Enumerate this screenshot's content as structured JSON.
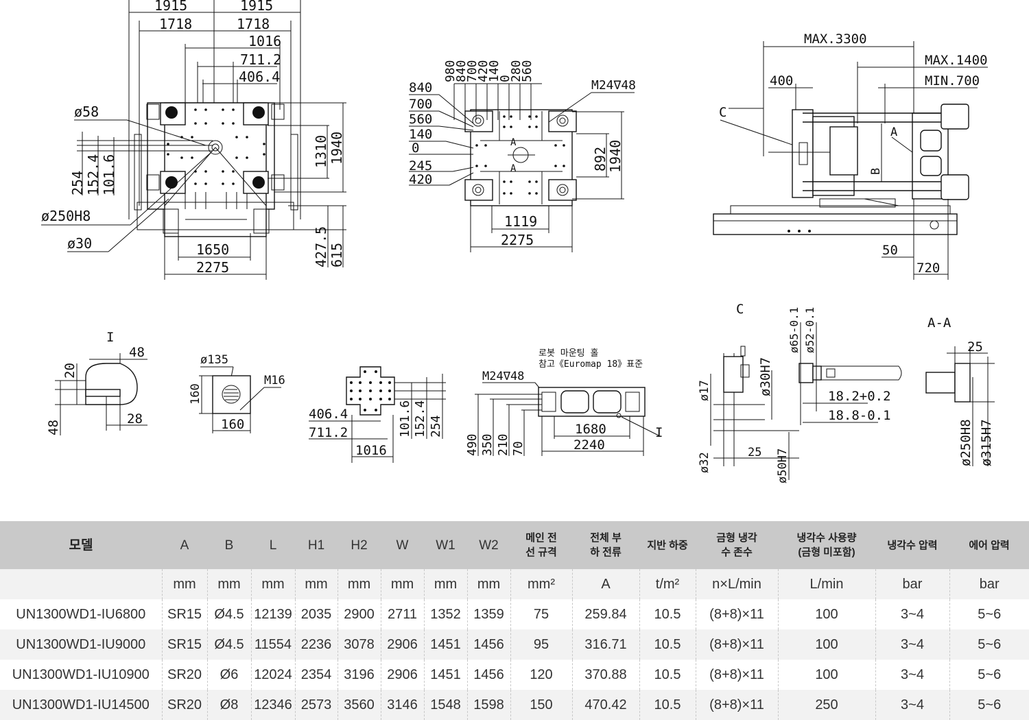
{
  "drawing_labels": {
    "top_1915_left": "1915",
    "top_1915_right": "1915",
    "top_1718_left": "1718",
    "top_1718_right": "1718",
    "top_1016": "1016",
    "top_711": "711.2",
    "top_406": "406.4",
    "phi58": "ø58",
    "d254": "254",
    "d152": "152.4",
    "d101": "101.6",
    "phi250": "ø250H8",
    "phi30": "ø30",
    "d1310": "1310",
    "d1940a": "1940",
    "d1650": "1650",
    "d2275a": "2275",
    "d427": "427.5",
    "d615": "615",
    "mid_980": "980",
    "mid_840v": "840",
    "mid_700v": "700",
    "mid_420v": "420",
    "mid_140v": "140",
    "mid_0v": "0",
    "mid_280v": "280",
    "mid_560v": "560",
    "mid_840": "840",
    "mid_700": "700",
    "mid_560": "560",
    "mid_140": "140",
    "mid_0": "0",
    "mid_245": "245",
    "mid_420": "420",
    "m24_top": "M24∇48",
    "d892": "892",
    "d1940b": "1940",
    "d1119": "1119",
    "d2275b": "2275",
    "sec_a": "A",
    "max3300": "MAX.3300",
    "max1400": "MAX.1400",
    "min700": "MIN.700",
    "d400": "400",
    "label_c": "C",
    "label_a": "A",
    "label_b": "B",
    "d50": "50",
    "d720": "720",
    "det_i": "I",
    "det_i_48a": "48",
    "det_i_20": "20",
    "det_i_48b": "48",
    "det_i_28": "28",
    "phi135": "ø135",
    "m16": "M16",
    "d160v": "160",
    "d160h": "160",
    "det2_406": "406.4",
    "det2_711": "711.2",
    "det2_1016": "1016",
    "det2_101": "101.6",
    "det2_152": "152.4",
    "det2_254": "254",
    "robot_note_1": "로봇 마운팅 홀",
    "robot_note_2": "참고《Euromap 18》표준",
    "m24_bottom": "M24∇48",
    "d490": "490",
    "d350": "350",
    "d210": "210",
    "d70": "70",
    "d1680": "1680",
    "d2240": "2240",
    "det_i_ref": "I",
    "sec_c": "C",
    "phi17": "ø17",
    "phi30h7": "ø30H7",
    "phi65": "ø65-0.1",
    "phi52": "ø52-0.1",
    "d18_2": "18.2+0.2",
    "d18_8": "18.8-0.1",
    "phi32": "ø32",
    "d25c": "25",
    "phi50h7": "ø50H7",
    "sec_aa": "A-A",
    "d25aa": "25",
    "phi250h8": "ø250H8",
    "phi315h7": "ø315H7"
  },
  "table": {
    "headers": [
      "모델",
      "A",
      "B",
      "L",
      "H1",
      "H2",
      "W",
      "W1",
      "W2",
      "메인 전\n선 규격",
      "전체 부\n하 전류",
      "지반 하중",
      "금형 냉각\n수 존수",
      "냉각수 사용량\n(금형 미포함)",
      "냉각수 압력",
      "에어 압력"
    ],
    "units": [
      "",
      "mm",
      "mm",
      "mm",
      "mm",
      "mm",
      "mm",
      "mm",
      "mm",
      "mm²",
      "A",
      "t/m²",
      "n×L/min",
      "L/min",
      "bar",
      "bar"
    ],
    "rows": [
      [
        "UN1300WD1-IU6800",
        "SR15",
        "Ø4.5",
        "12139",
        "2035",
        "2900",
        "2711",
        "1352",
        "1359",
        "75",
        "259.84",
        "10.5",
        "(8+8)×11",
        "100",
        "3~4",
        "5~6"
      ],
      [
        "UN1300WD1-IU9000",
        "SR15",
        "Ø4.5",
        "11554",
        "2236",
        "3078",
        "2906",
        "1451",
        "1456",
        "95",
        "316.71",
        "10.5",
        "(8+8)×11",
        "100",
        "3~4",
        "5~6"
      ],
      [
        "UN1300WD1-IU10900",
        "SR20",
        "Ø6",
        "12024",
        "2354",
        "3196",
        "2906",
        "1451",
        "1456",
        "120",
        "370.88",
        "10.5",
        "(8+8)×11",
        "100",
        "3~4",
        "5~6"
      ],
      [
        "UN1300WD1-IU14500",
        "SR20",
        "Ø8",
        "12346",
        "2573",
        "3560",
        "3146",
        "1548",
        "1598",
        "150",
        "470.42",
        "10.5",
        "(8+8)×11",
        "250",
        "3~4",
        "5~6"
      ]
    ]
  }
}
